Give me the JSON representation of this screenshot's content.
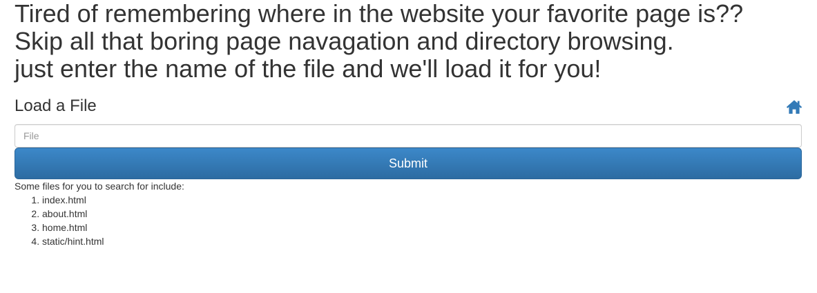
{
  "intro": {
    "lines": [
      "Tired of remembering where in the website your favorite page is??",
      "Skip all that boring page navagation and directory browsing.",
      "just enter the name of the file and we'll load it for you!"
    ]
  },
  "form": {
    "title": "Load a File",
    "home_icon": "home-icon",
    "file_placeholder": "File",
    "file_value": "",
    "submit_label": "Submit",
    "accent_color": "#337ab7",
    "icon_color": "#337ab7"
  },
  "suggestions": {
    "hint": "Some files for you to search for include:",
    "files": [
      "index.html",
      "about.html",
      "home.html",
      "static/hint.html"
    ]
  }
}
